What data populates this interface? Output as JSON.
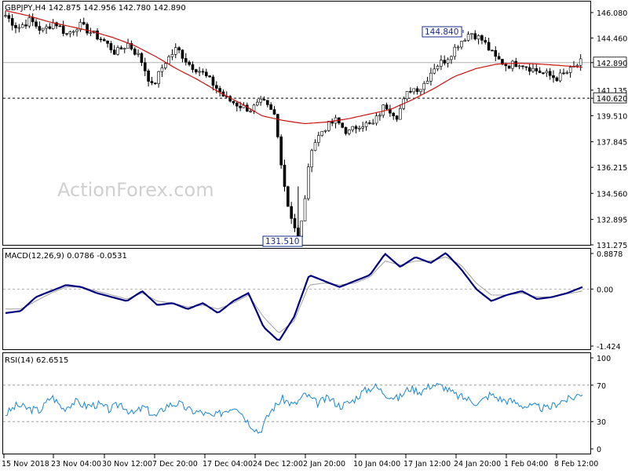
{
  "chart_data": [
    {
      "type": "candlestick",
      "title": "GBPJPY,H4 142.875 142.956 142.780 142.890",
      "ylim": [
        131.275,
        146.0
      ],
      "y_ticks": [
        "146.080",
        "144.460",
        "142.890",
        "141.135",
        "140.620",
        "139.510",
        "137.845",
        "136.215",
        "134.560",
        "132.895",
        "131.275"
      ],
      "x_ticks": [
        "15 Nov 2018",
        "23 Nov 04:00",
        "30 Nov 12:00",
        "7 Dec 20:00",
        "17 Dec 04:00",
        "24 Dec 12:00",
        "2 Jan 20:00",
        "10 Jan 04:00",
        "17 Jan 12:00",
        "24 Jan 20:00",
        "1 Feb 04:00",
        "8 Feb 12:00"
      ],
      "price_path": [
        145.9,
        145.1,
        145.6,
        144.9,
        145.5,
        144.7,
        145.3,
        144.8,
        144.3,
        143.5,
        144.1,
        143.2,
        141.3,
        142.9,
        143.8,
        142.8,
        142.3,
        141.5,
        140.6,
        140.2,
        139.9,
        140.4,
        139.5,
        134.0,
        131.5,
        137.5,
        138.7,
        139.2,
        138.4,
        139.0,
        138.9,
        140.2,
        139.5,
        141.2,
        141.3,
        142.6,
        143.1,
        144.1,
        144.84,
        144.3,
        143.2,
        142.7,
        142.9,
        142.5,
        142.2,
        141.9,
        142.3,
        142.9
      ],
      "ema_path": [
        146.2,
        145.9,
        145.5,
        145.2,
        144.9,
        144.5,
        144.0,
        143.3,
        142.5,
        141.8,
        141.0,
        140.3,
        139.5,
        139.2,
        139.0,
        139.1,
        139.3,
        139.6,
        139.9,
        140.5,
        141.2,
        142.0,
        142.5,
        142.8,
        142.85,
        142.8,
        142.7,
        142.6
      ],
      "annotations": [
        {
          "label": "144.840",
          "value": 144.84
        },
        {
          "label": "131.510",
          "value": 131.51
        },
        {
          "label": "142.890",
          "value": 142.89,
          "kind": "current-price"
        },
        {
          "label": "140.620",
          "value": 140.62,
          "kind": "support-line"
        }
      ],
      "grid": false
    },
    {
      "type": "line",
      "title": "MACD(12,26,9) 0.0786 -0.0531",
      "ylim": [
        -1.424,
        0.8878
      ],
      "y_ticks": [
        "0.8878",
        "0.00",
        "-1.424"
      ],
      "series": [
        {
          "values": [
            -0.6,
            -0.55,
            -0.2,
            -0.05,
            0.1,
            0.05,
            -0.1,
            -0.2,
            -0.3,
            -0.05,
            -0.4,
            -0.35,
            -0.5,
            -0.35,
            -0.6,
            -0.3,
            -0.1,
            -0.95,
            -1.3,
            -0.7,
            0.35,
            0.2,
            0.05,
            0.2,
            0.35,
            0.88,
            0.55,
            0.8,
            0.65,
            0.9,
            0.5,
            0.0,
            -0.3,
            -0.15,
            -0.05,
            -0.25,
            -0.2,
            -0.1,
            0.05
          ]
        },
        {
          "values": [
            -0.5,
            -0.5,
            -0.3,
            -0.1,
            0.05,
            0.05,
            -0.05,
            -0.15,
            -0.25,
            -0.1,
            -0.3,
            -0.35,
            -0.45,
            -0.4,
            -0.5,
            -0.35,
            -0.15,
            -0.7,
            -1.1,
            -0.8,
            0.1,
            0.15,
            0.1,
            0.15,
            0.3,
            0.7,
            0.6,
            0.7,
            0.7,
            0.8,
            0.6,
            0.15,
            -0.15,
            -0.15,
            -0.1,
            -0.2,
            -0.2,
            -0.12,
            -0.05
          ]
        }
      ],
      "colors": {
        "macd": "#000080",
        "signal": "#a0a0a0"
      }
    },
    {
      "type": "line",
      "title": "RSI(14) 62.6515",
      "ylim": [
        0,
        100
      ],
      "y_ticks": [
        "100",
        "70",
        "30",
        "0"
      ],
      "levels": [
        70,
        30
      ],
      "series": [
        {
          "values": [
            38,
            48,
            44,
            42,
            58,
            44,
            52,
            47,
            49,
            43,
            50,
            38,
            46,
            35,
            48,
            50,
            42,
            40,
            35,
            42,
            48,
            30,
            18,
            42,
            55,
            48,
            60,
            50,
            56,
            47,
            52,
            63,
            69,
            60,
            55,
            67,
            63,
            71,
            68,
            59,
            55,
            50,
            60,
            54,
            52,
            47,
            46,
            44,
            52,
            55,
            62
          ]
        }
      ],
      "colors": {
        "rsi": "#1c86d1"
      }
    }
  ],
  "watermark": "ActionForex.com"
}
